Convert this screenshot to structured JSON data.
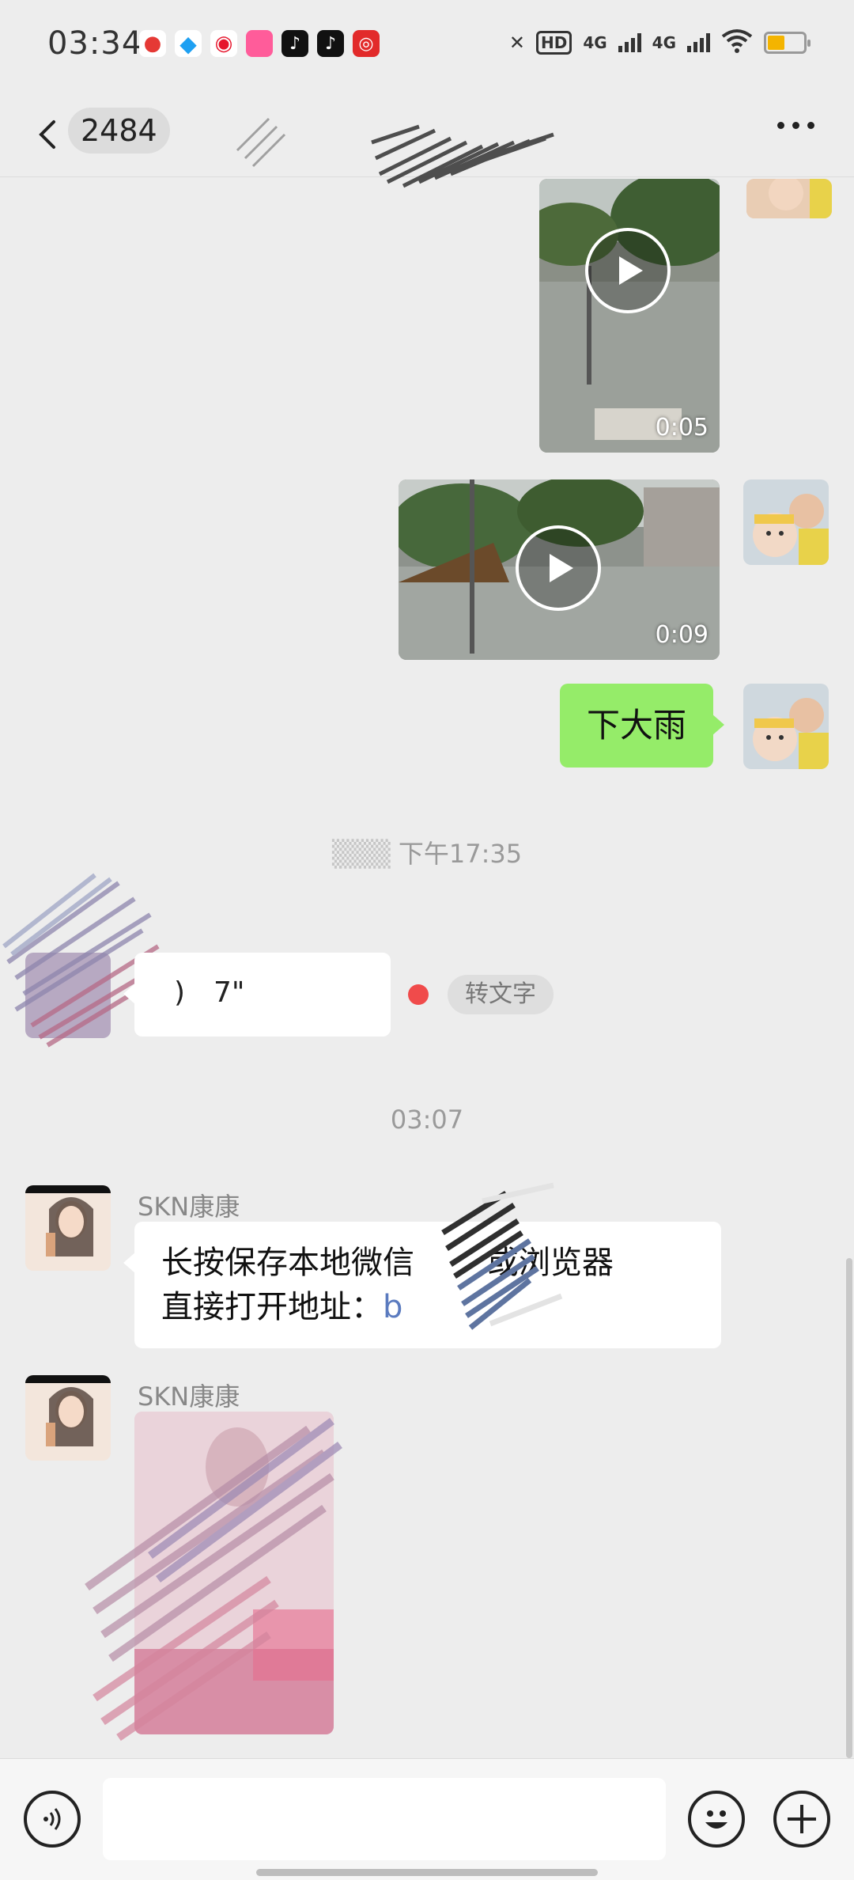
{
  "status_bar": {
    "time": "03:34",
    "notification_icons": [
      "map-pin-icon",
      "qq-icon",
      "weibo-icon",
      "app-icon",
      "tiktok-icon",
      "tiktok-icon",
      "netease-music-icon"
    ],
    "network_hd": "HD",
    "network_1": "4G",
    "network_2": "4G",
    "battery_level": 0.45
  },
  "header": {
    "unread_count": "2484",
    "more_icon": "more-dots-icon"
  },
  "messages": {
    "video1_duration": "0:05",
    "video2_duration": "0:09",
    "text_out": "下大雨",
    "timestamp1": "下午17:35",
    "voice_duration": "7\"",
    "to_text_label": "转文字",
    "timestamp2": "03:07",
    "sender1": "SKN康康",
    "text_in_line1": "长按保存本地微信",
    "text_in_line1b": "或浏览器",
    "text_in_line2": "直接打开地址：",
    "sender2": "SKN康康"
  },
  "input": {
    "placeholder": ""
  },
  "colors": {
    "bubble_green": "#95ec69",
    "background": "#ededed",
    "unread_dot": "#f04b4b"
  }
}
